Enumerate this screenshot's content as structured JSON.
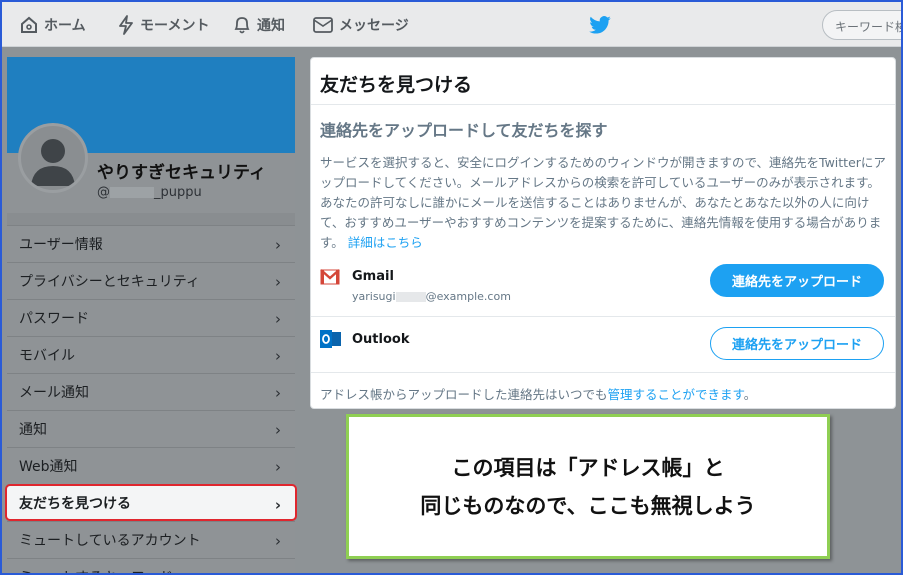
{
  "nav": {
    "home": "ホーム",
    "moments": "モーメント",
    "notifications": "通知",
    "messages": "メッセージ",
    "search_placeholder": "キーワード検"
  },
  "profile": {
    "name": "やりすぎセキュリティ",
    "handle_prefix": "@",
    "handle_suffix": "_puppu"
  },
  "menu": [
    {
      "label": "ユーザー情報"
    },
    {
      "label": "プライバシーとセキュリティ"
    },
    {
      "label": "パスワード"
    },
    {
      "label": "モバイル"
    },
    {
      "label": "メール通知"
    },
    {
      "label": "通知"
    },
    {
      "label": "Web通知"
    },
    {
      "label": "友だちを見つける"
    },
    {
      "label": "ミュートしているアカウント"
    },
    {
      "label": "ミュートするキーワード"
    }
  ],
  "panel": {
    "title": "友だちを見つける",
    "section_title": "連絡先をアップロードして友だちを探す",
    "description": "サービスを選択すると、安全にログインするためのウィンドウが開きますので、連絡先をTwitterにアップロードしてください。メールアドレスからの検索を許可しているユーザーのみが表示されます。あなたの許可なしに誰かにメールを送信することはありませんが、あなたとあなた以外の人に向けて、おすすめユーザーやおすすめコンテンツを提案するために、連絡先情報を使用する場合があります。",
    "details_link": "詳細はこちら",
    "services": [
      {
        "name": "Gmail",
        "email_prefix": "yarisugi",
        "email_suffix": "@example.com",
        "button": "連絡先をアップロード"
      },
      {
        "name": "Outlook",
        "button": "連絡先をアップロード"
      }
    ],
    "footer_text": "アドレス帳からアップロードした連絡先はいつでも",
    "footer_link": "管理することができます",
    "footer_end": "。"
  },
  "callout": {
    "line1": "この項目は「アドレス帳」と",
    "line2": "同じものなので、ここも無視しよう"
  },
  "colors": {
    "accent": "#1da1f2",
    "highlight_border": "#e0262e",
    "callout_border": "#8fcf53",
    "banner": "#1f7fc0"
  }
}
